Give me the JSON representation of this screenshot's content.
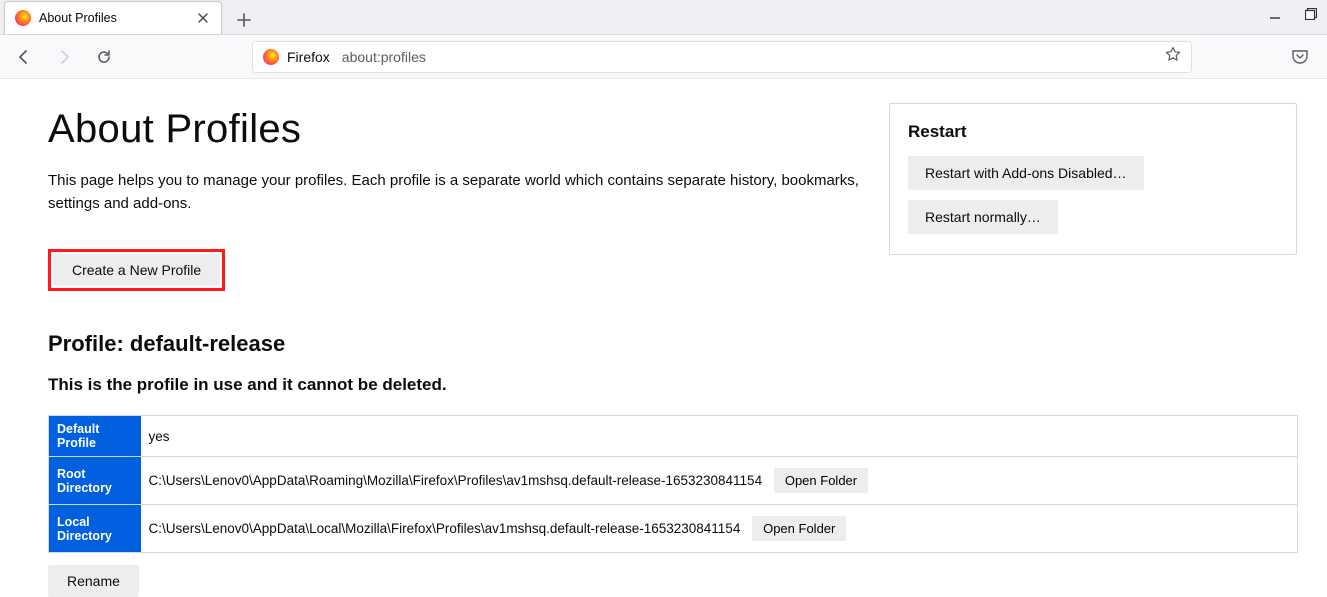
{
  "window": {
    "tabs": [
      {
        "title": "About Profiles"
      }
    ]
  },
  "toolbar": {
    "brand": "Firefox",
    "address": "about:profiles"
  },
  "page": {
    "heading": "About Profiles",
    "description": "This page helps you to manage your profiles. Each profile is a separate world which contains separate history, bookmarks, settings and add-ons.",
    "create_label": "Create a New Profile"
  },
  "restart": {
    "heading": "Restart",
    "addons_disabled_label": "Restart with Add-ons Disabled…",
    "normally_label": "Restart normally…"
  },
  "profile": {
    "profile_label_prefix": "Profile: ",
    "profile_name": "default-release",
    "in_use_text": "This is the profile in use and it cannot be deleted.",
    "rows": {
      "default_profile": {
        "label": "Default Profile",
        "value": "yes"
      },
      "root_directory": {
        "label": "Root Directory",
        "value": "C:\\Users\\Lenov0\\AppData\\Roaming\\Mozilla\\Firefox\\Profiles\\av1mshsq.default-release-1653230841154",
        "open_label": "Open Folder"
      },
      "local_directory": {
        "label": "Local Directory",
        "value": "C:\\Users\\Lenov0\\AppData\\Local\\Mozilla\\Firefox\\Profiles\\av1mshsq.default-release-1653230841154",
        "open_label": "Open Folder"
      }
    },
    "rename_label": "Rename"
  }
}
